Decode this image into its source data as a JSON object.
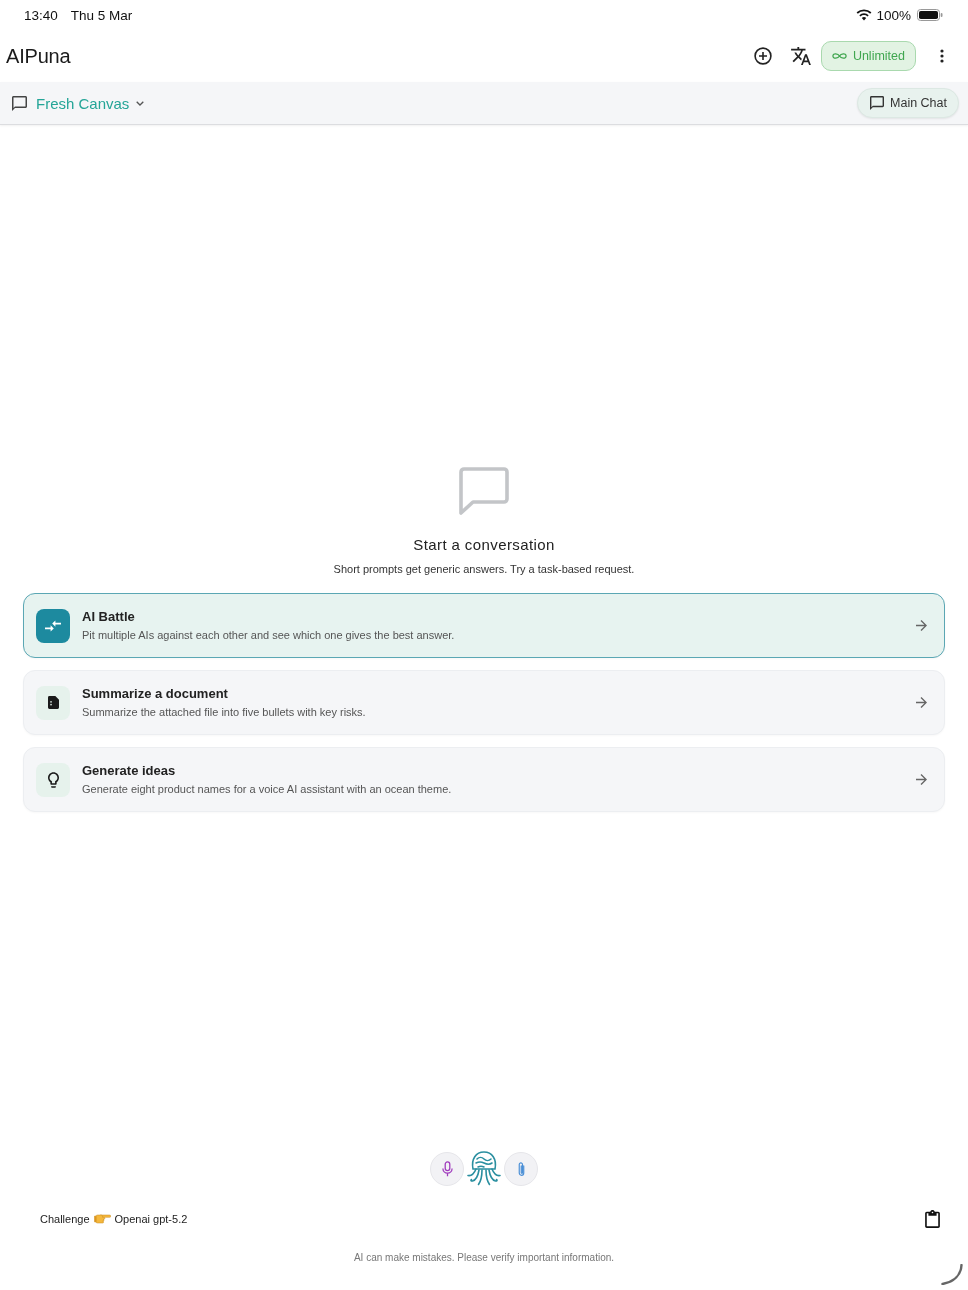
{
  "status_bar": {
    "time": "13:40",
    "date": "Thu 5 Mar",
    "battery": "100%"
  },
  "app_bar": {
    "title": "AIPuna",
    "plan_badge": "Unlimited"
  },
  "chat_bar": {
    "conversation": "Fresh Canvas",
    "main_chat_button": "Main Chat"
  },
  "empty_state": {
    "title": "Start a conversation",
    "subtitle": "Short prompts get generic answers. Try a task-based request."
  },
  "suggestions": [
    {
      "kind": "battle",
      "title": "AI Battle",
      "description": "Pit multiple AIs against each other and see which one gives the best answer.",
      "selected": true
    },
    {
      "kind": "document",
      "title": "Summarize a document",
      "description": "Summarize the attached file into five bullets with key risks.",
      "selected": false
    },
    {
      "kind": "idea",
      "title": "Generate ideas",
      "description": "Generate eight product names for a voice AI assistant with an ocean theme.",
      "selected": false
    }
  ],
  "composer": {
    "mode": "Challenge",
    "model": "Openai gpt-5.2"
  },
  "footer": {
    "disclaimer": "AI can make mistakes. Please verify important information."
  }
}
